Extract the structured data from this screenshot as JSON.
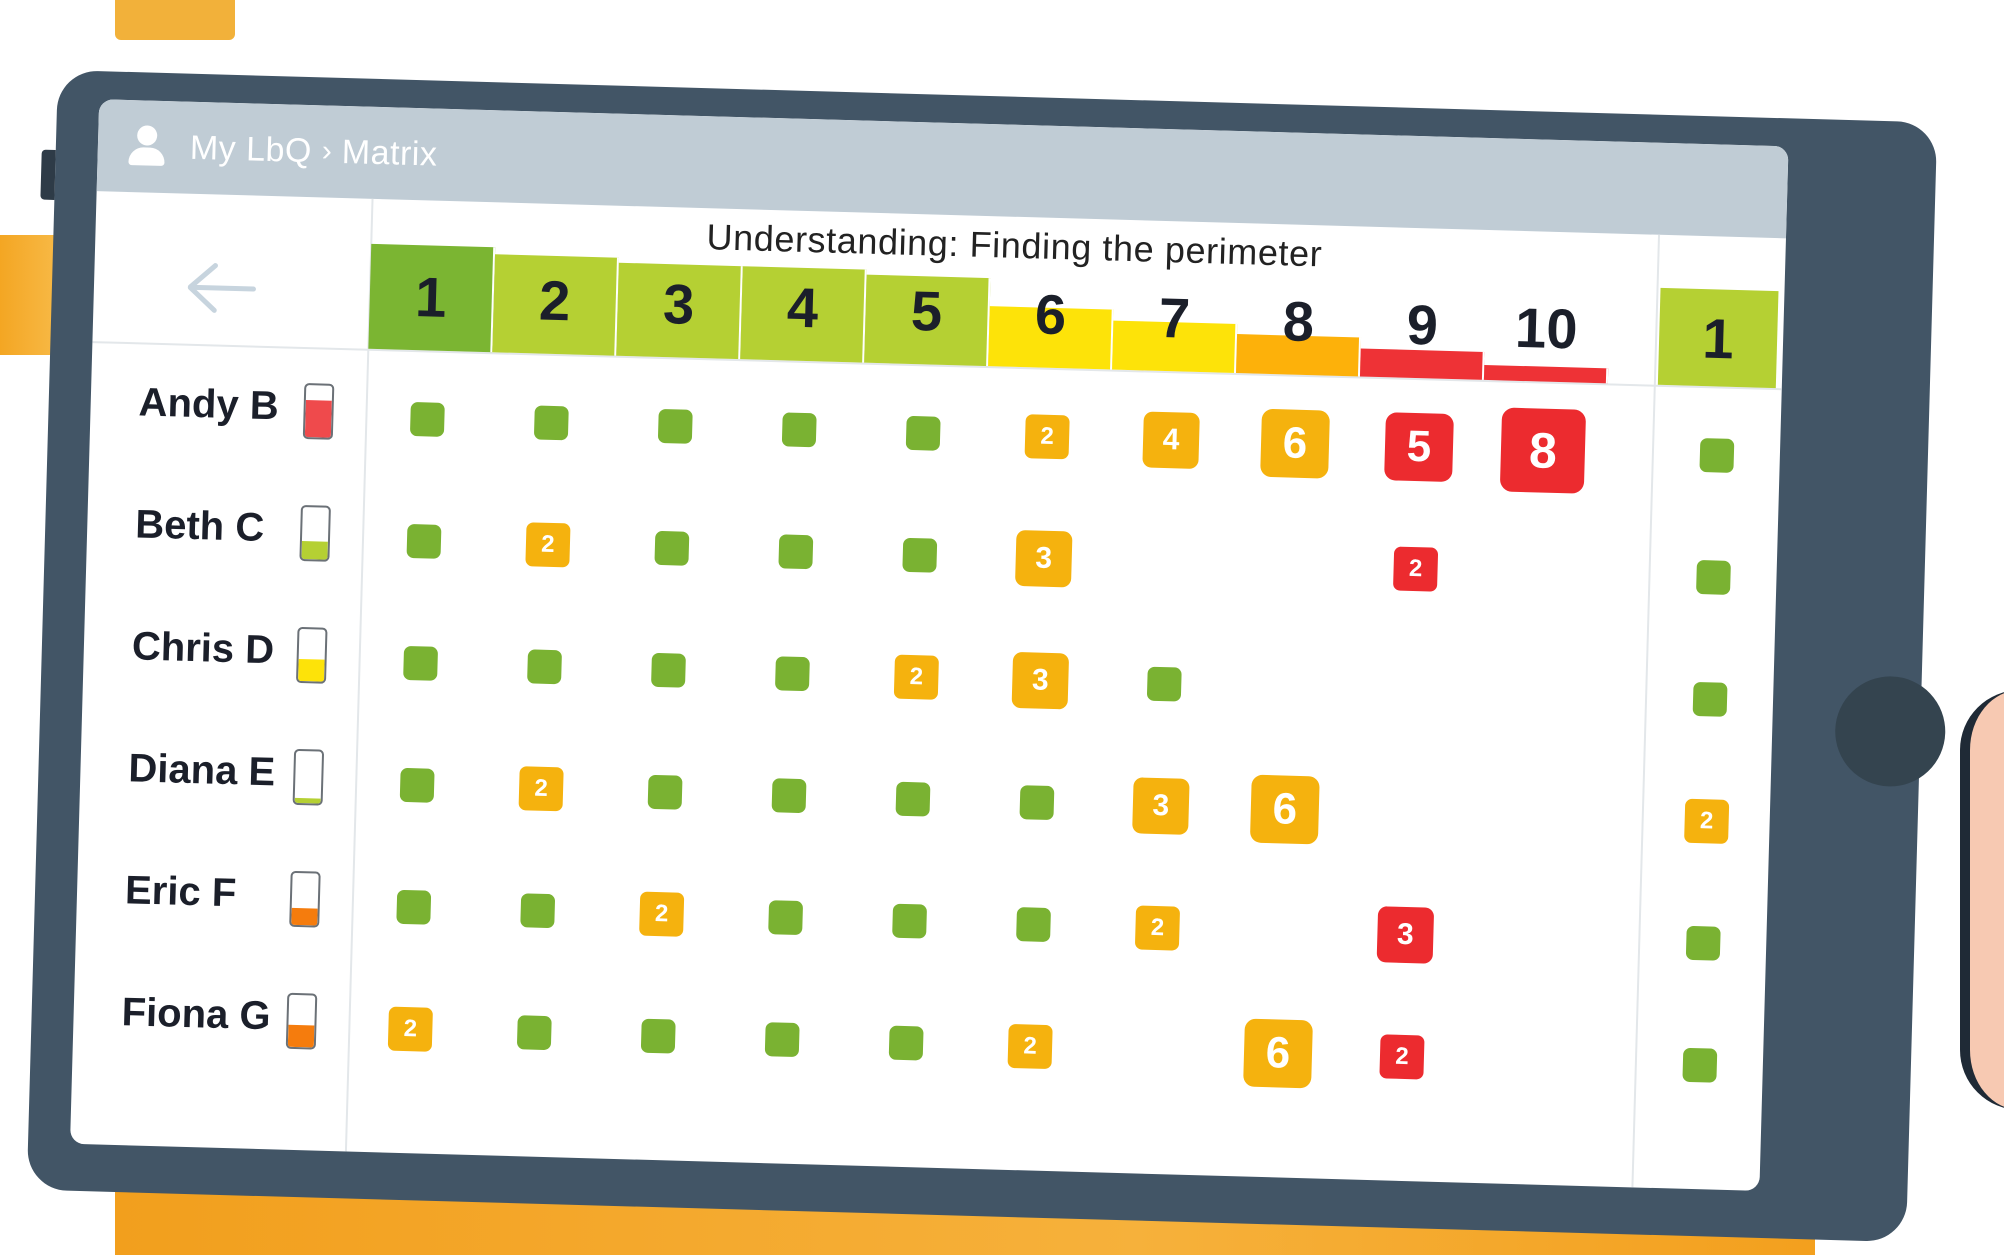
{
  "app": {
    "breadcrumb": [
      "My LbQ",
      "Matrix"
    ],
    "breadcrumb_separator": "›"
  },
  "matrix": {
    "title": "Understanding: Finding the perimeter",
    "questions": [
      {
        "label": "1",
        "color": "#7bb532",
        "level": 1.0
      },
      {
        "label": "2",
        "color": "#b5d033",
        "level": 0.93
      },
      {
        "label": "3",
        "color": "#b5d033",
        "level": 0.87
      },
      {
        "label": "4",
        "color": "#b5d033",
        "level": 0.87
      },
      {
        "label": "5",
        "color": "#b5d033",
        "level": 0.82
      },
      {
        "label": "6",
        "color": "#fde309",
        "level": 0.53
      },
      {
        "label": "7",
        "color": "#fde309",
        "level": 0.41
      },
      {
        "label": "8",
        "color": "#fdb10a",
        "level": 0.3
      },
      {
        "label": "9",
        "color": "#ee3236",
        "level": 0.19
      },
      {
        "label": "10",
        "color": "#ee3236",
        "level": 0.05
      }
    ],
    "extra_question": {
      "label": "1",
      "color": "#b5d033"
    },
    "students": [
      {
        "name": "Andy B",
        "battery_level": 0.72,
        "battery_color": "#ef4a4c",
        "marks": [
          [
            "g"
          ],
          [
            "g"
          ],
          [
            "g"
          ],
          [
            "g"
          ],
          [
            "g"
          ],
          [
            "o",
            "2"
          ],
          [
            "o",
            "4"
          ],
          [
            "o",
            "6"
          ],
          [
            "r",
            "5"
          ],
          [
            "r",
            "8"
          ]
        ],
        "extra": [
          "g"
        ]
      },
      {
        "name": "Beth C",
        "battery_level": 0.35,
        "battery_color": "#b5d033",
        "marks": [
          [
            "g"
          ],
          [
            "o",
            "2"
          ],
          [
            "g"
          ],
          [
            "g"
          ],
          [
            "g"
          ],
          [
            "o",
            "3"
          ],
          [],
          [],
          [
            "r",
            "2"
          ],
          []
        ],
        "extra": [
          "g"
        ]
      },
      {
        "name": "Chris D",
        "battery_level": 0.42,
        "battery_color": "#fde309",
        "marks": [
          [
            "g"
          ],
          [
            "g"
          ],
          [
            "g"
          ],
          [
            "g"
          ],
          [
            "o",
            "2"
          ],
          [
            "o",
            "3"
          ],
          [
            "g"
          ],
          [],
          [],
          []
        ],
        "extra": [
          "g"
        ]
      },
      {
        "name": "Diana E",
        "battery_level": 0.1,
        "battery_color": "#b5d033",
        "marks": [
          [
            "g"
          ],
          [
            "o",
            "2"
          ],
          [
            "g"
          ],
          [
            "g"
          ],
          [
            "g"
          ],
          [
            "g"
          ],
          [
            "o",
            "3"
          ],
          [
            "o",
            "6"
          ],
          [],
          []
        ],
        "extra": [
          "o",
          "2"
        ]
      },
      {
        "name": "Eric F",
        "battery_level": 0.32,
        "battery_color": "#f57c0d",
        "marks": [
          [
            "g"
          ],
          [
            "g"
          ],
          [
            "o",
            "2"
          ],
          [
            "g"
          ],
          [
            "g"
          ],
          [
            "g"
          ],
          [
            "o",
            "2"
          ],
          [],
          [
            "r",
            "3"
          ],
          []
        ],
        "extra": [
          "g"
        ]
      },
      {
        "name": "Fiona G",
        "battery_level": 0.42,
        "battery_color": "#f57c0d",
        "marks": [
          [
            "o",
            "2"
          ],
          [
            "g"
          ],
          [
            "g"
          ],
          [
            "g"
          ],
          [
            "g"
          ],
          [
            "o",
            "2"
          ],
          [],
          [
            "o",
            "6"
          ],
          [
            "r",
            "2"
          ],
          []
        ],
        "extra": [
          "g"
        ]
      }
    ]
  }
}
